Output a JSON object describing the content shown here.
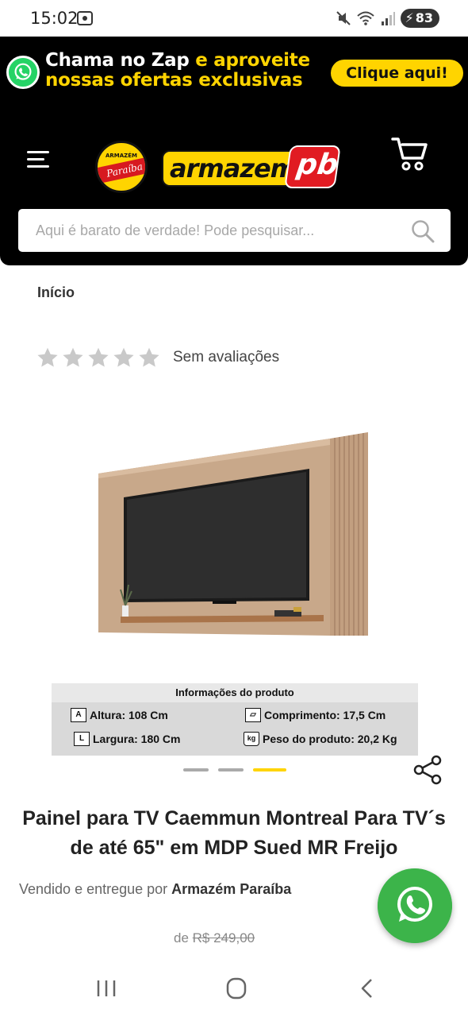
{
  "status_bar": {
    "time": "15:02",
    "battery": "83"
  },
  "promo": {
    "line1_white": "Chama no Zap",
    "line1_yellow": "e aproveite",
    "line2": "nossas ofertas exclusivas",
    "cta": "Clique aqui!"
  },
  "logo": {
    "circle_top": "ARMAZÉM",
    "circle_band": "Paraíba",
    "word_main": "armazem",
    "word_suffix": "pb"
  },
  "search": {
    "placeholder": "Aqui é barato de verdade! Pode pesquisar..."
  },
  "breadcrumb": {
    "home": "Início"
  },
  "rating": {
    "stars_filled": 0,
    "stars_total": 5,
    "label": "Sem avaliações"
  },
  "product_info": {
    "title": "Informações do produto",
    "height": "Altura: 108 Cm",
    "length": "Comprimento: 17,5 Cm",
    "width": "Largura: 180 Cm",
    "weight": "Peso do produto: 20,2 Kg",
    "icon_a": "A",
    "icon_l": "L",
    "icon_kg": "kg"
  },
  "carousel": {
    "count": 3,
    "active_index": 2
  },
  "product": {
    "title": "Painel para TV Caemmun Montreal Para TV´s de até 65\" em MDP Sued MR Freijo",
    "seller_prefix": "Vendido e entregue por",
    "seller_name": "Armazém Paraíba",
    "price_prefix": "de",
    "old_price": "R$ 249,00"
  },
  "colors": {
    "header_bg": "#000000",
    "brand_yellow": "#ffd400",
    "brand_red": "#e11b22",
    "whatsapp_green": "#3cb44a"
  },
  "icons": [
    "notification-icon",
    "mute-icon",
    "wifi-icon",
    "signal-icon",
    "whatsapp-icon",
    "menu-icon",
    "cart-icon",
    "search-icon",
    "star-icon",
    "share-icon",
    "recents-icon",
    "home-icon",
    "back-icon"
  ]
}
